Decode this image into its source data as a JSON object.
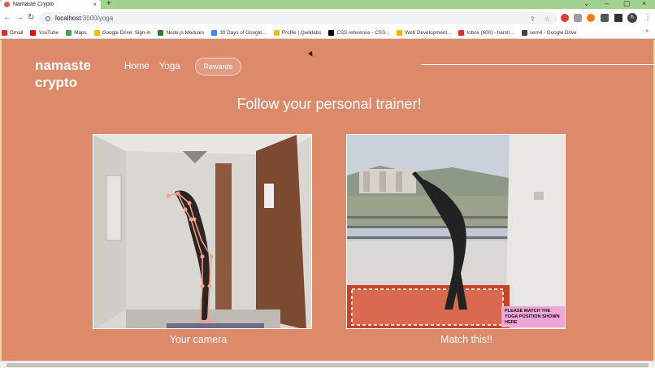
{
  "browser": {
    "tab_title": "Namaste Crypto",
    "tab_close": "×",
    "new_tab": "+",
    "url_host": "localhost",
    "url_path": ":3000/yoga",
    "bookmarks": [
      {
        "label": "Gmail",
        "icon": "gmail-icon",
        "color": "#d93025"
      },
      {
        "label": "YouTube",
        "icon": "youtube-icon",
        "color": "#ff0000"
      },
      {
        "label": "Maps",
        "icon": "maps-icon",
        "color": "#34a853"
      },
      {
        "label": "Google Drive: Sign-in",
        "icon": "drive-icon",
        "color": "#fbbc04"
      },
      {
        "label": "Node.js Modules",
        "icon": "node-icon",
        "color": "#2e7d32"
      },
      {
        "label": "30 Days of Google...",
        "icon": "google-icon",
        "color": "#4285f4"
      },
      {
        "label": "Profile | Qwiklabs",
        "icon": "drive-icon",
        "color": "#fbbc04"
      },
      {
        "label": "CSS reference - CSS...",
        "icon": "mdn-icon",
        "color": "#000000"
      },
      {
        "label": "Web Development...",
        "icon": "bookmark-icon",
        "color": "#f4b400"
      },
      {
        "label": "Inbox (600) - harsh...",
        "icon": "gmail-icon",
        "color": "#d93025"
      },
      {
        "label": "sem4 - Google Drive",
        "icon": "globe-icon",
        "color": "#444444"
      }
    ],
    "bookmarks_more": "»",
    "avatar_letter": "h"
  },
  "nav": {
    "brand": "namaste\ncrypto",
    "links": [
      "Home",
      "Yoga"
    ],
    "rewards": "Rewards"
  },
  "main": {
    "headline": "Follow your personal trainer!",
    "left_caption": "Your camera",
    "right_caption": "Match this!!",
    "match_note": "PLEASE MATCH THE YOGA POSITION SHOWN HERE"
  },
  "colors": {
    "page_bg": "#dd8a6b",
    "accent_border": "#f0d3a4",
    "note_bg": "#f1a6d9",
    "skeleton": "#f4a38a"
  }
}
